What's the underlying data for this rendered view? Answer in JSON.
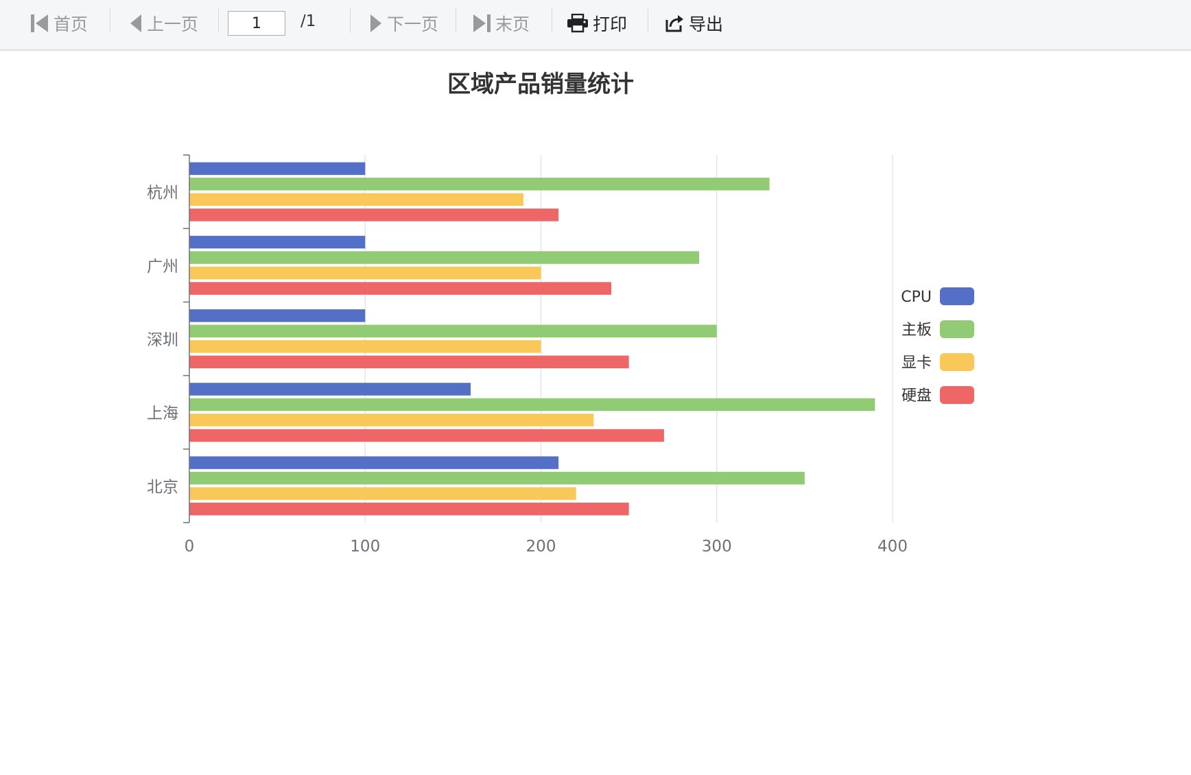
{
  "toolbar": {
    "first_label": "首页",
    "prev_label": "上一页",
    "page_value": "1",
    "page_total": "/1",
    "next_label": "下一页",
    "last_label": "末页",
    "print_label": "打印",
    "export_label": "导出",
    "icons": {
      "first": "first-page-icon",
      "prev": "prev-page-icon",
      "next": "next-page-icon",
      "last": "last-page-icon",
      "print": "printer-icon",
      "export": "export-icon"
    }
  },
  "chart_data": {
    "type": "bar",
    "orientation": "horizontal",
    "title": "区域产品销量统计",
    "categories": [
      "北京",
      "上海",
      "深圳",
      "广州",
      "杭州"
    ],
    "series": [
      {
        "name": "CPU",
        "color": "#5470c6",
        "values": [
          210,
          160,
          100,
          100,
          100
        ]
      },
      {
        "name": "主板",
        "color": "#91cc75",
        "values": [
          350,
          390,
          300,
          290,
          330
        ]
      },
      {
        "name": "显卡",
        "color": "#fac858",
        "values": [
          220,
          230,
          200,
          200,
          190
        ]
      },
      {
        "name": "硬盘",
        "color": "#ee6666",
        "values": [
          250,
          270,
          250,
          240,
          210
        ]
      }
    ],
    "x_ticks": [
      "0",
      "100",
      "200",
      "300",
      "400"
    ],
    "xlim": [
      0,
      400
    ],
    "grid": true,
    "legend_position": "right"
  }
}
